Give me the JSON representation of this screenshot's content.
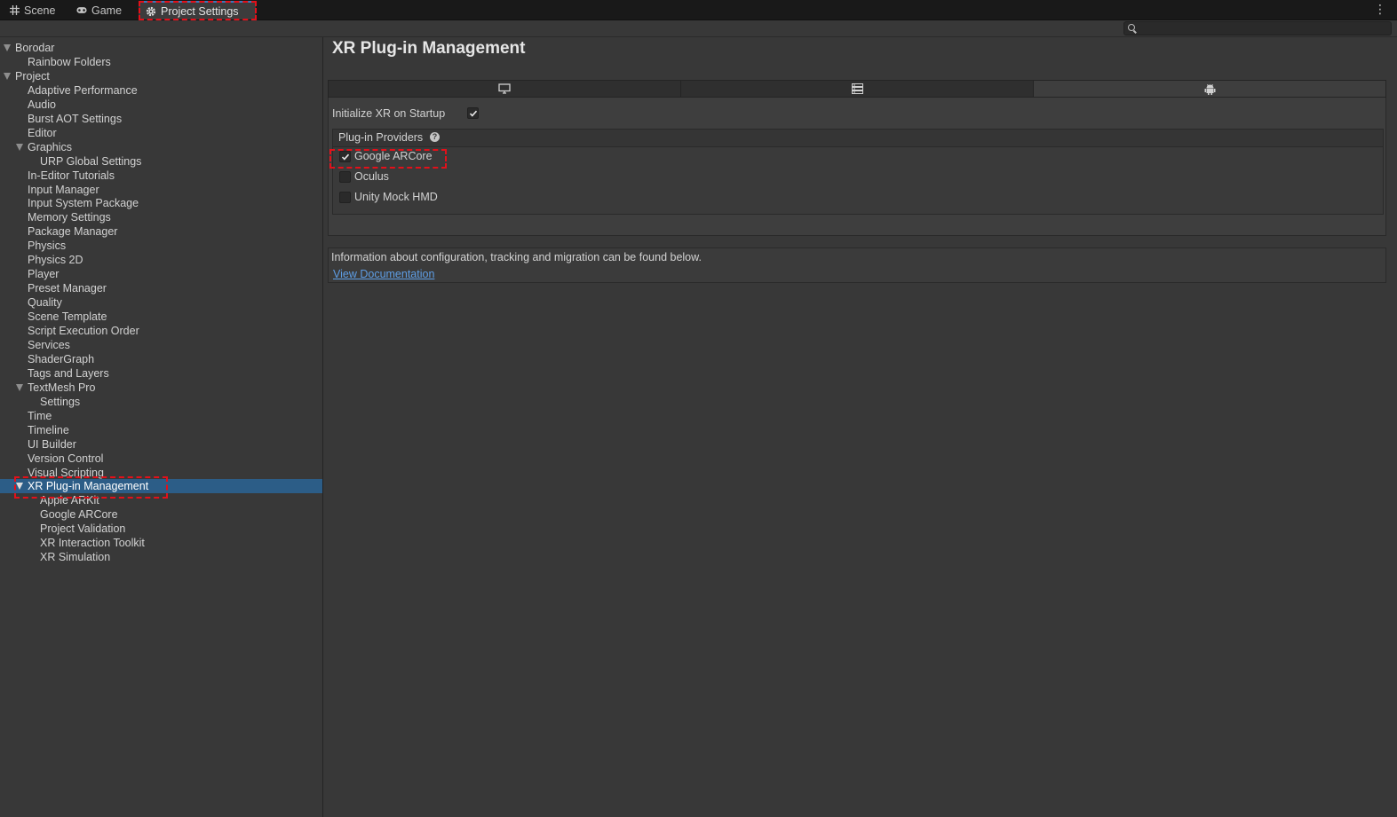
{
  "tabs": [
    {
      "label": "Scene",
      "icon": "grid-icon"
    },
    {
      "label": "Game",
      "icon": "gamepad-icon"
    },
    {
      "label": "Project Settings",
      "icon": "gear-icon"
    }
  ],
  "search": {
    "placeholder": "",
    "value": ""
  },
  "sidebar": {
    "items": [
      {
        "label": "Borodar",
        "expanded": true
      },
      {
        "label": "Rainbow Folders"
      },
      {
        "label": "Project",
        "expanded": true
      },
      {
        "label": "Adaptive Performance"
      },
      {
        "label": "Audio"
      },
      {
        "label": "Burst AOT Settings"
      },
      {
        "label": "Editor"
      },
      {
        "label": "Graphics",
        "expanded": true
      },
      {
        "label": "URP Global Settings"
      },
      {
        "label": "In-Editor Tutorials"
      },
      {
        "label": "Input Manager"
      },
      {
        "label": "Input System Package"
      },
      {
        "label": "Memory Settings"
      },
      {
        "label": "Package Manager"
      },
      {
        "label": "Physics"
      },
      {
        "label": "Physics 2D"
      },
      {
        "label": "Player"
      },
      {
        "label": "Preset Manager"
      },
      {
        "label": "Quality"
      },
      {
        "label": "Scene Template"
      },
      {
        "label": "Script Execution Order"
      },
      {
        "label": "Services"
      },
      {
        "label": "ShaderGraph"
      },
      {
        "label": "Tags and Layers"
      },
      {
        "label": "TextMesh Pro",
        "expanded": true
      },
      {
        "label": "Settings"
      },
      {
        "label": "Time"
      },
      {
        "label": "Timeline"
      },
      {
        "label": "UI Builder"
      },
      {
        "label": "Version Control"
      },
      {
        "label": "Visual Scripting"
      },
      {
        "label": "XR Plug-in Management",
        "expanded": true,
        "selected": true
      },
      {
        "label": "Apple ARKit"
      },
      {
        "label": "Google ARCore"
      },
      {
        "label": "Project Validation"
      },
      {
        "label": "XR Interaction Toolkit"
      },
      {
        "label": "XR Simulation"
      }
    ]
  },
  "main": {
    "title": "XR Plug-in Management",
    "platform_tabs": [
      {
        "icon": "desktop-icon",
        "selected": false
      },
      {
        "icon": "server-icon",
        "selected": false
      },
      {
        "icon": "android-icon",
        "selected": true
      }
    ],
    "init_on_startup": {
      "label": "Initialize XR on Startup",
      "checked": true
    },
    "providers": {
      "title": "Plug-in Providers",
      "items": [
        {
          "label": "Google ARCore",
          "checked": true
        },
        {
          "label": "Oculus",
          "checked": false
        },
        {
          "label": "Unity Mock HMD",
          "checked": false
        }
      ]
    },
    "info": {
      "text": "Information about configuration, tracking and migration can be found below.",
      "link": "View Documentation"
    }
  },
  "colors": {
    "background": "#383838",
    "selection": "#2c5d87",
    "link": "#5e9ee6",
    "highlight": "#e3101a"
  }
}
